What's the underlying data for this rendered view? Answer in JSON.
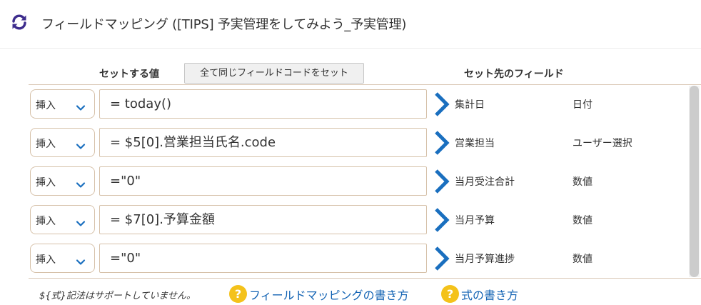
{
  "header": {
    "title": "フィールドマッピング ([TIPS] 予実管理をしてみよう_予実管理)",
    "icon": "refresh-icon",
    "accent": "#3d2c8d"
  },
  "columns": {
    "value_header": "セットする値",
    "set_all_button": "全て同じフィールドコードをセット",
    "field_header": "セット先のフィールド"
  },
  "rows": [
    {
      "mode": "挿入",
      "expression": "= today()",
      "field": "集計日",
      "type": "日付"
    },
    {
      "mode": "挿入",
      "expression": "= $5[0].営業担当氏名.code",
      "field": "営業担当",
      "type": "ユーザー選択"
    },
    {
      "mode": "挿入",
      "expression": "=\"0\"",
      "field": "当月受注合計",
      "type": "数値"
    },
    {
      "mode": "挿入",
      "expression": "= $7[0].予算金額",
      "field": "当月予算",
      "type": "数値"
    },
    {
      "mode": "挿入",
      "expression": "=\"0\"",
      "field": "当月予算進捗",
      "type": "数値"
    }
  ],
  "footer": {
    "note": "${式}記法はサポートしていません。",
    "help_mapping": "フィールドマッピングの書き方",
    "help_formula": "式の書き方",
    "help_icon_char": "?",
    "link_color": "#1464b4",
    "help_icon_color": "#f4c21b"
  },
  "colors": {
    "arrow": "#1a6fbf",
    "chevron": "#1a6fbf",
    "border": "#d6c1a9"
  }
}
